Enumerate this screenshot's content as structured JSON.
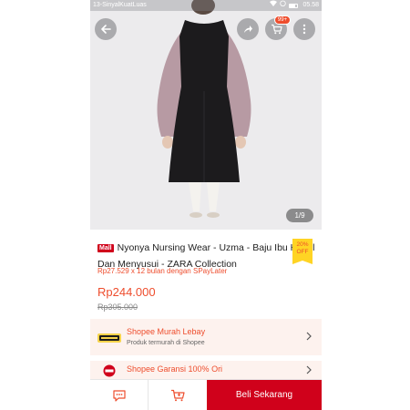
{
  "status_bar": {
    "carrier": "13-SinyalKuatLuas",
    "time": "05.58"
  },
  "overlay": {
    "cart_badge": "99+",
    "page_indicator": "1/9"
  },
  "product": {
    "mall_badge": "Mall",
    "title": "Nyonya Nursing Wear - Uzma - Baju Ibu Hamil Dan Menyusui - ZARA Collection",
    "discount_percent": "20%",
    "discount_label": "OFF",
    "installment": "Rp27.529 x 12 bulan dengan SPayLater",
    "price": "Rp244.000",
    "original_price": "Rp305.000"
  },
  "promos": [
    {
      "title": "Shopee Murah Lebay",
      "subtitle": "Produk termurah di Shopee",
      "icon": "murah-lebay-icon"
    },
    {
      "title": "Shopee Garansi 100% Ori",
      "icon": "ori-badge-icon"
    }
  ],
  "bottom_bar": {
    "buy_label": "Beli Sekarang"
  },
  "colors": {
    "accent": "#ee4d2d",
    "mall": "#d0011b",
    "promo_bg": "#fdf2ee"
  }
}
